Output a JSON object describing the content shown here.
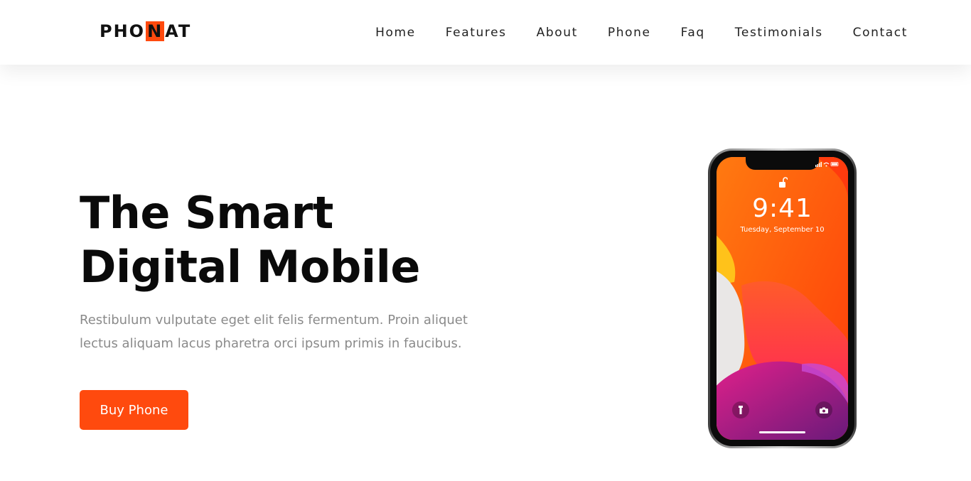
{
  "brand": {
    "logo_prefix": "PHO",
    "logo_highlight": "N",
    "logo_suffix": "AT",
    "accent_color": "#ff4a0e"
  },
  "nav": {
    "items": [
      {
        "label": "Home"
      },
      {
        "label": "Features"
      },
      {
        "label": "About"
      },
      {
        "label": "Phone"
      },
      {
        "label": "Faq"
      },
      {
        "label": "Testimonials"
      },
      {
        "label": "Contact"
      }
    ]
  },
  "hero": {
    "title_line1": "The Smart",
    "title_line2": "Digital Mobile",
    "description": "Restibulum vulputate eget elit felis fermentum. Proin aliquet lectus aliquam lacus pharetra orci ipsum primis in faucibus.",
    "button_label": "Buy Phone"
  },
  "phone": {
    "time": "9:41",
    "date": "Tuesday, September 10",
    "icons": [
      "lock-icon",
      "flashlight-icon",
      "camera-icon",
      "signal-icon",
      "wifi-icon",
      "battery-icon"
    ]
  }
}
